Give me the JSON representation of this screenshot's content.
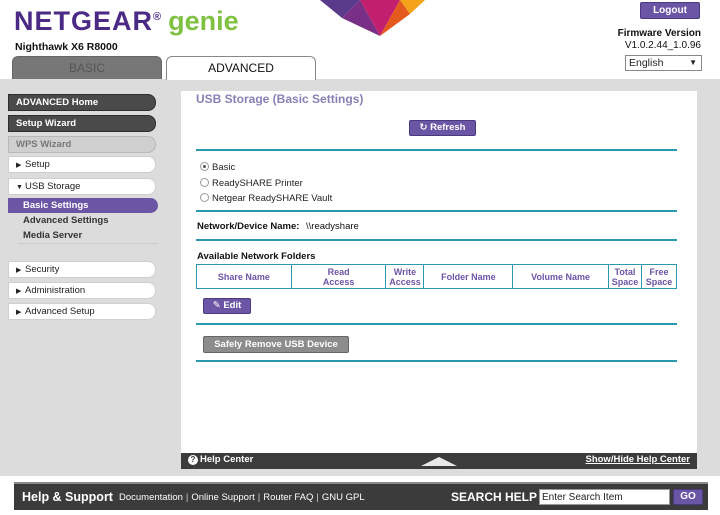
{
  "header": {
    "brand": "NETGEAR",
    "brand_product": "genie",
    "model": "Nighthawk X6 R8000",
    "logout_label": "Logout",
    "firmware_label": "Firmware Version",
    "firmware_value": "V1.0.2.44_1.0.96",
    "language": "English",
    "tabs": [
      "BASIC",
      "ADVANCED"
    ]
  },
  "sidebar": {
    "advanced_home": "ADVANCED Home",
    "setup_wizard": "Setup Wizard",
    "wps_wizard": "WPS Wizard",
    "setup": "Setup",
    "usb_storage": "USB Storage",
    "sub_items": [
      "Basic Settings",
      "Advanced Settings",
      "Media Server"
    ],
    "security": "Security",
    "administration": "Administration",
    "advanced_setup": "Advanced Setup"
  },
  "content": {
    "title": "USB Storage (Basic Settings)",
    "refresh_label": "Refresh",
    "options": [
      "Basic",
      "ReadySHARE Printer",
      "Netgear ReadySHARE Vault"
    ],
    "selected_option": "Basic",
    "network_device_label": "Network/Device Name:",
    "network_device_value": "\\\\readyshare",
    "available_folders_label": "Available Network Folders",
    "table_headers": [
      [
        "Share Name"
      ],
      [
        "Read",
        "Access"
      ],
      [
        "Write",
        "Access"
      ],
      [
        "Folder Name"
      ],
      [
        "Volume Name"
      ],
      [
        "Total",
        "Space"
      ],
      [
        "Free",
        "Space"
      ]
    ],
    "edit_label": "Edit",
    "remove_label": "Safely Remove USB Device"
  },
  "helpbar": {
    "help_center": "Help Center",
    "show_hide": "Show/Hide Help Center"
  },
  "footer": {
    "title": "Help & Support",
    "links": [
      "Documentation",
      "Online Support",
      "Router FAQ",
      "GNU GPL"
    ],
    "search_label": "SEARCH HELP",
    "search_placeholder": "Enter Search Item",
    "go_label": "GO"
  },
  "colors": {
    "accent_purple": "#6b55a5",
    "divider_teal": "#2a99b0",
    "genie_green": "#7fc242"
  }
}
